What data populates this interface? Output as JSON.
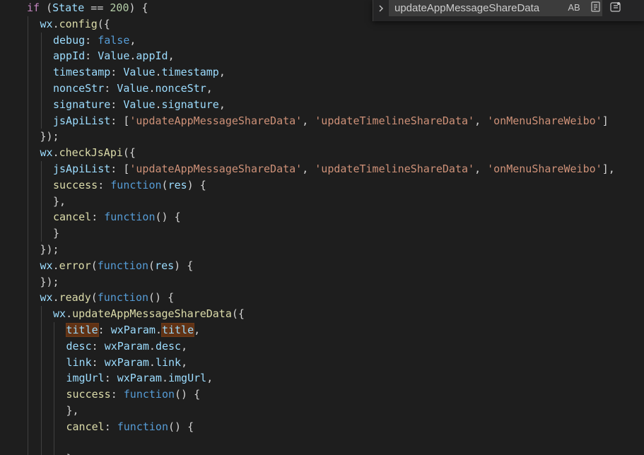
{
  "find_widget": {
    "query": "updateAppMessageShareData",
    "match_case_label": "AB"
  },
  "colors": {
    "background": "#1e1e1e",
    "keyword": "#569cd6",
    "control": "#c586c0",
    "string": "#ce9178",
    "function": "#dcdcaa",
    "variable": "#9cdcfe",
    "number": "#b5cea8",
    "match_highlight": "#613214"
  },
  "code_lines": [
    {
      "indent": 0,
      "tokens": [
        {
          "t": "if",
          "c": "ctl"
        },
        {
          "t": " (",
          "c": "pl"
        },
        {
          "t": "State",
          "c": "var"
        },
        {
          "t": " == ",
          "c": "pl"
        },
        {
          "t": "200",
          "c": "num"
        },
        {
          "t": ") {",
          "c": "pl"
        }
      ]
    },
    {
      "indent": 1,
      "tokens": [
        {
          "t": "wx",
          "c": "var"
        },
        {
          "t": ".",
          "c": "pl"
        },
        {
          "t": "config",
          "c": "fn"
        },
        {
          "t": "({",
          "c": "pl"
        }
      ]
    },
    {
      "indent": 2,
      "tokens": [
        {
          "t": "debug",
          "c": "prop"
        },
        {
          "t": ": ",
          "c": "pl"
        },
        {
          "t": "false",
          "c": "kw"
        },
        {
          "t": ",",
          "c": "pl"
        }
      ]
    },
    {
      "indent": 2,
      "tokens": [
        {
          "t": "appId",
          "c": "prop"
        },
        {
          "t": ": ",
          "c": "pl"
        },
        {
          "t": "Value",
          "c": "var"
        },
        {
          "t": ".",
          "c": "pl"
        },
        {
          "t": "appId",
          "c": "prop"
        },
        {
          "t": ",",
          "c": "pl"
        }
      ]
    },
    {
      "indent": 2,
      "tokens": [
        {
          "t": "timestamp",
          "c": "prop"
        },
        {
          "t": ": ",
          "c": "pl"
        },
        {
          "t": "Value",
          "c": "var"
        },
        {
          "t": ".",
          "c": "pl"
        },
        {
          "t": "timestamp",
          "c": "prop"
        },
        {
          "t": ",",
          "c": "pl"
        }
      ]
    },
    {
      "indent": 2,
      "tokens": [
        {
          "t": "nonceStr",
          "c": "prop"
        },
        {
          "t": ": ",
          "c": "pl"
        },
        {
          "t": "Value",
          "c": "var"
        },
        {
          "t": ".",
          "c": "pl"
        },
        {
          "t": "nonceStr",
          "c": "prop"
        },
        {
          "t": ",",
          "c": "pl"
        }
      ]
    },
    {
      "indent": 2,
      "tokens": [
        {
          "t": "signature",
          "c": "prop"
        },
        {
          "t": ": ",
          "c": "pl"
        },
        {
          "t": "Value",
          "c": "var"
        },
        {
          "t": ".",
          "c": "pl"
        },
        {
          "t": "signature",
          "c": "prop"
        },
        {
          "t": ",",
          "c": "pl"
        }
      ]
    },
    {
      "indent": 2,
      "tokens": [
        {
          "t": "jsApiList",
          "c": "prop"
        },
        {
          "t": ": [",
          "c": "pl"
        },
        {
          "t": "'updateAppMessageShareData'",
          "c": "str"
        },
        {
          "t": ", ",
          "c": "pl"
        },
        {
          "t": "'updateTimelineShareData'",
          "c": "str"
        },
        {
          "t": ", ",
          "c": "pl"
        },
        {
          "t": "'onMenuShareWeibo'",
          "c": "str"
        },
        {
          "t": "]",
          "c": "pl"
        }
      ]
    },
    {
      "indent": 1,
      "tokens": [
        {
          "t": "});",
          "c": "pl"
        }
      ]
    },
    {
      "indent": 1,
      "tokens": [
        {
          "t": "wx",
          "c": "var"
        },
        {
          "t": ".",
          "c": "pl"
        },
        {
          "t": "checkJsApi",
          "c": "fn"
        },
        {
          "t": "({",
          "c": "pl"
        }
      ]
    },
    {
      "indent": 2,
      "tokens": [
        {
          "t": "jsApiList",
          "c": "prop"
        },
        {
          "t": ": [",
          "c": "pl"
        },
        {
          "t": "'updateAppMessageShareData'",
          "c": "str"
        },
        {
          "t": ", ",
          "c": "pl"
        },
        {
          "t": "'updateTimelineShareData'",
          "c": "str"
        },
        {
          "t": ", ",
          "c": "pl"
        },
        {
          "t": "'onMenuShareWeibo'",
          "c": "str"
        },
        {
          "t": "],",
          "c": "pl"
        }
      ]
    },
    {
      "indent": 2,
      "tokens": [
        {
          "t": "success",
          "c": "fn"
        },
        {
          "t": ": ",
          "c": "pl"
        },
        {
          "t": "function",
          "c": "kw"
        },
        {
          "t": "(",
          "c": "pl"
        },
        {
          "t": "res",
          "c": "var"
        },
        {
          "t": ") {",
          "c": "pl"
        }
      ]
    },
    {
      "indent": 2,
      "tokens": [
        {
          "t": "},",
          "c": "pl"
        }
      ]
    },
    {
      "indent": 2,
      "tokens": [
        {
          "t": "cancel",
          "c": "fn"
        },
        {
          "t": ": ",
          "c": "pl"
        },
        {
          "t": "function",
          "c": "kw"
        },
        {
          "t": "() {",
          "c": "pl"
        }
      ]
    },
    {
      "indent": 2,
      "tokens": [
        {
          "t": "}",
          "c": "pl"
        }
      ]
    },
    {
      "indent": 1,
      "tokens": [
        {
          "t": "});",
          "c": "pl"
        }
      ]
    },
    {
      "indent": 1,
      "tokens": [
        {
          "t": "wx",
          "c": "var"
        },
        {
          "t": ".",
          "c": "pl"
        },
        {
          "t": "error",
          "c": "fn"
        },
        {
          "t": "(",
          "c": "pl"
        },
        {
          "t": "function",
          "c": "kw"
        },
        {
          "t": "(",
          "c": "pl"
        },
        {
          "t": "res",
          "c": "var"
        },
        {
          "t": ") {",
          "c": "pl"
        }
      ]
    },
    {
      "indent": 1,
      "tokens": [
        {
          "t": "});",
          "c": "pl"
        }
      ]
    },
    {
      "indent": 1,
      "tokens": [
        {
          "t": "wx",
          "c": "var"
        },
        {
          "t": ".",
          "c": "pl"
        },
        {
          "t": "ready",
          "c": "fn"
        },
        {
          "t": "(",
          "c": "pl"
        },
        {
          "t": "function",
          "c": "kw"
        },
        {
          "t": "() {",
          "c": "pl"
        }
      ]
    },
    {
      "indent": 2,
      "tokens": [
        {
          "t": "wx",
          "c": "var"
        },
        {
          "t": ".",
          "c": "pl"
        },
        {
          "t": "updateAppMessageShareData",
          "c": "fn"
        },
        {
          "t": "({",
          "c": "pl"
        }
      ]
    },
    {
      "indent": 3,
      "tokens": [
        {
          "t": "title",
          "c": "prop",
          "hl": true
        },
        {
          "t": ": ",
          "c": "pl"
        },
        {
          "t": "wxParam",
          "c": "var"
        },
        {
          "t": ".",
          "c": "pl"
        },
        {
          "t": "title",
          "c": "prop",
          "hl": true
        },
        {
          "t": ",",
          "c": "pl"
        }
      ]
    },
    {
      "indent": 3,
      "tokens": [
        {
          "t": "desc",
          "c": "prop"
        },
        {
          "t": ": ",
          "c": "pl"
        },
        {
          "t": "wxParam",
          "c": "var"
        },
        {
          "t": ".",
          "c": "pl"
        },
        {
          "t": "desc",
          "c": "prop"
        },
        {
          "t": ",",
          "c": "pl"
        }
      ]
    },
    {
      "indent": 3,
      "tokens": [
        {
          "t": "link",
          "c": "prop"
        },
        {
          "t": ": ",
          "c": "pl"
        },
        {
          "t": "wxParam",
          "c": "var"
        },
        {
          "t": ".",
          "c": "pl"
        },
        {
          "t": "link",
          "c": "prop"
        },
        {
          "t": ",",
          "c": "pl"
        }
      ]
    },
    {
      "indent": 3,
      "tokens": [
        {
          "t": "imgUrl",
          "c": "prop"
        },
        {
          "t": ": ",
          "c": "pl"
        },
        {
          "t": "wxParam",
          "c": "var"
        },
        {
          "t": ".",
          "c": "pl"
        },
        {
          "t": "imgUrl",
          "c": "prop"
        },
        {
          "t": ",",
          "c": "pl"
        }
      ]
    },
    {
      "indent": 3,
      "tokens": [
        {
          "t": "success",
          "c": "fn"
        },
        {
          "t": ": ",
          "c": "pl"
        },
        {
          "t": "function",
          "c": "kw"
        },
        {
          "t": "() {",
          "c": "pl"
        }
      ]
    },
    {
      "indent": 3,
      "tokens": [
        {
          "t": "},",
          "c": "pl"
        }
      ]
    },
    {
      "indent": 3,
      "tokens": [
        {
          "t": "cancel",
          "c": "fn"
        },
        {
          "t": ": ",
          "c": "pl"
        },
        {
          "t": "function",
          "c": "kw"
        },
        {
          "t": "() {",
          "c": "pl"
        }
      ]
    },
    {
      "indent": 3,
      "tokens": []
    },
    {
      "indent": 3,
      "tokens": [
        {
          "t": "}",
          "c": "pl"
        }
      ]
    }
  ]
}
